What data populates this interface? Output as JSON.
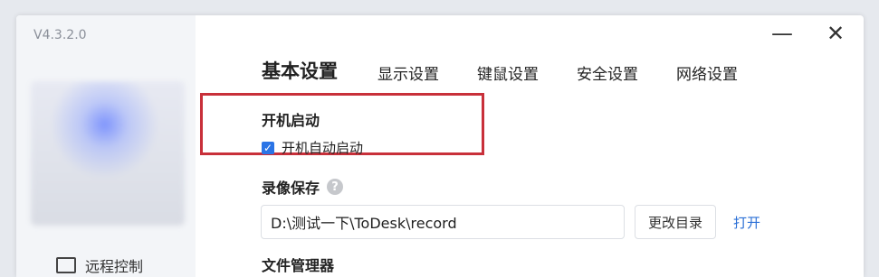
{
  "app": {
    "version": "V4.3.2.0"
  },
  "window_controls": {
    "minimize": "—",
    "close": "✕"
  },
  "sidebar": {
    "items": [
      {
        "label": "远程控制",
        "icon": "monitor-icon"
      }
    ]
  },
  "tabs": [
    {
      "label": "基本设置",
      "active": true
    },
    {
      "label": "显示设置",
      "active": false
    },
    {
      "label": "键鼠设置",
      "active": false
    },
    {
      "label": "安全设置",
      "active": false
    },
    {
      "label": "网络设置",
      "active": false
    }
  ],
  "startup": {
    "title": "开机启动",
    "checkbox_label": "开机自动启动",
    "checked": true
  },
  "recording": {
    "title": "录像保存",
    "help_glyph": "?",
    "path_value": "D:\\测试一下\\ToDesk\\record",
    "change_button": "更改目录",
    "open_link": "打开"
  },
  "file_manager": {
    "title": "文件管理器"
  },
  "colors": {
    "highlight": "#c8303a",
    "accent": "#2a74e6",
    "link": "#2a6fd6"
  }
}
